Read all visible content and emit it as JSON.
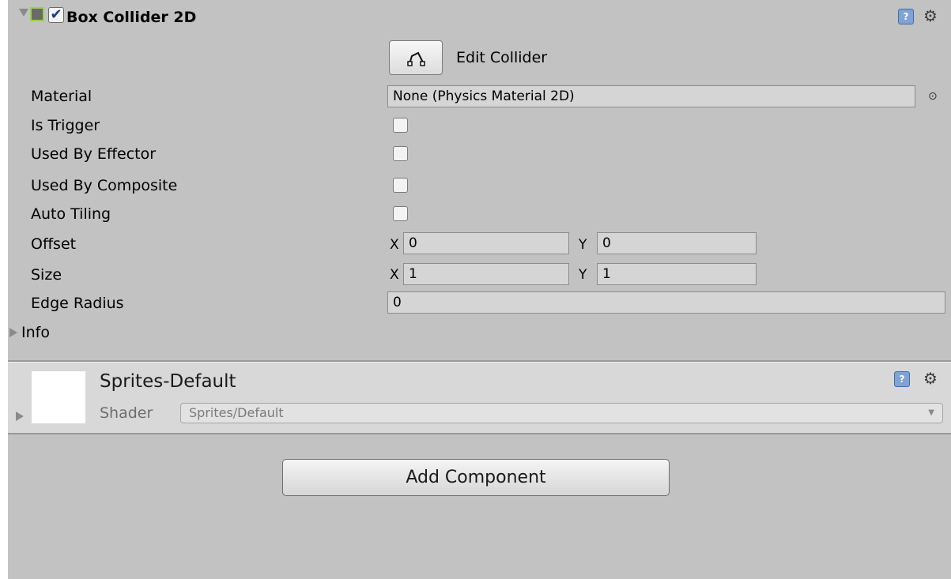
{
  "component": {
    "title": "Box Collider 2D",
    "enabled": true,
    "help_icon": "help-book-icon",
    "settings_icon": "gear-icon",
    "edit_collider": {
      "icon": "edit-shape-icon",
      "label": "Edit Collider"
    },
    "fields": {
      "material": {
        "label": "Material",
        "value": "None (Physics Material 2D)"
      },
      "is_trigger": {
        "label": "Is Trigger",
        "checked": false
      },
      "used_by_effector": {
        "label": "Used By Effector",
        "checked": false
      },
      "used_by_composite": {
        "label": "Used By Composite",
        "checked": false
      },
      "auto_tiling": {
        "label": "Auto Tiling",
        "checked": false
      },
      "offset": {
        "label": "Offset",
        "x_label": "X",
        "x": "0",
        "y_label": "Y",
        "y": "0"
      },
      "size": {
        "label": "Size",
        "x_label": "X",
        "x": "1",
        "y_label": "Y",
        "y": "1"
      },
      "edge_radius": {
        "label": "Edge Radius",
        "value": "0"
      }
    },
    "info": {
      "label": "Info"
    }
  },
  "material": {
    "name": "Sprites-Default",
    "shader_label": "Shader",
    "shader_value": "Sprites/Default"
  },
  "footer": {
    "add_component_label": "Add Component"
  },
  "colors": {
    "panel_bg": "#c2c2c2",
    "field_bg": "#d5d5d5",
    "component_icon_outline": "#9bd04a"
  }
}
